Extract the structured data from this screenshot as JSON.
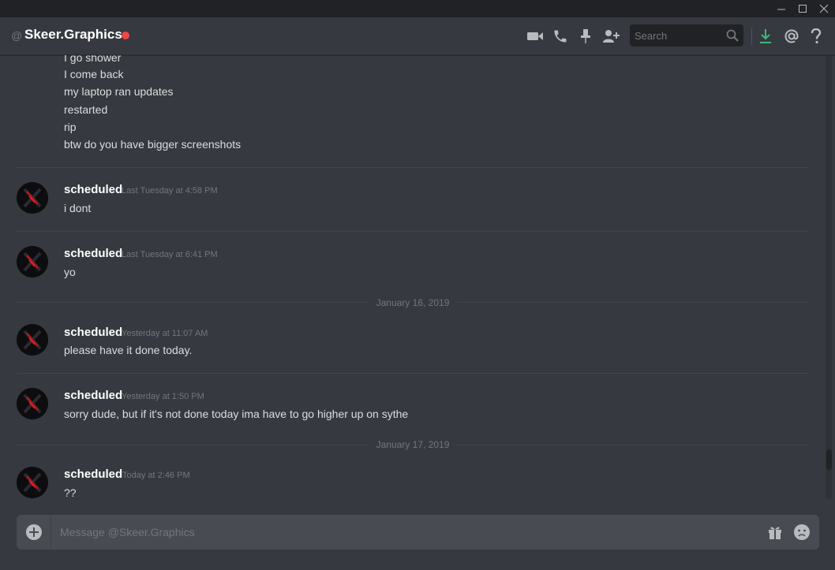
{
  "window": {
    "controls": [
      "minimize-icon",
      "maximize-icon",
      "close-icon"
    ]
  },
  "header": {
    "at_symbol": "@",
    "channel_name": "Skeer.Graphics",
    "status_color": "#f04747",
    "search_placeholder": "Search",
    "icons": [
      "video-call-icon",
      "voice-call-icon",
      "pin-icon",
      "add-friend-icon",
      "search-icon",
      "download-icon",
      "mention-icon",
      "help-icon"
    ]
  },
  "messages": {
    "top_lines": [
      "I go shower",
      "I come back",
      "my laptop ran updates",
      "restarted",
      "rip",
      "btw do you have bigger screenshots"
    ],
    "groups": [
      {
        "author": "scheduled",
        "timestamp": "Last Tuesday at 4:58 PM",
        "text": "i dont"
      },
      {
        "author": "scheduled",
        "timestamp": "Last Tuesday at 6:41 PM",
        "text": "yo"
      },
      {
        "author": "scheduled",
        "timestamp": "Yesterday at 11:07 AM",
        "text": "please have it done today."
      },
      {
        "author": "scheduled",
        "timestamp": "Yesterday at 1:50 PM",
        "text": "sorry dude, but if it's not done today ima have to go higher up on sythe"
      },
      {
        "author": "scheduled",
        "timestamp": "Today at 2:46 PM",
        "text": "??"
      }
    ],
    "date_dividers": [
      "January 16, 2019",
      "January 17, 2019"
    ]
  },
  "composer": {
    "placeholder": "Message @Skeer.Graphics",
    "icons": [
      "upload-plus-icon",
      "gift-icon",
      "emoji-icon"
    ]
  },
  "colors": {
    "background": "#36393f",
    "titlebar": "#202225",
    "composer": "#484c52",
    "download_accent": "#43b581"
  }
}
